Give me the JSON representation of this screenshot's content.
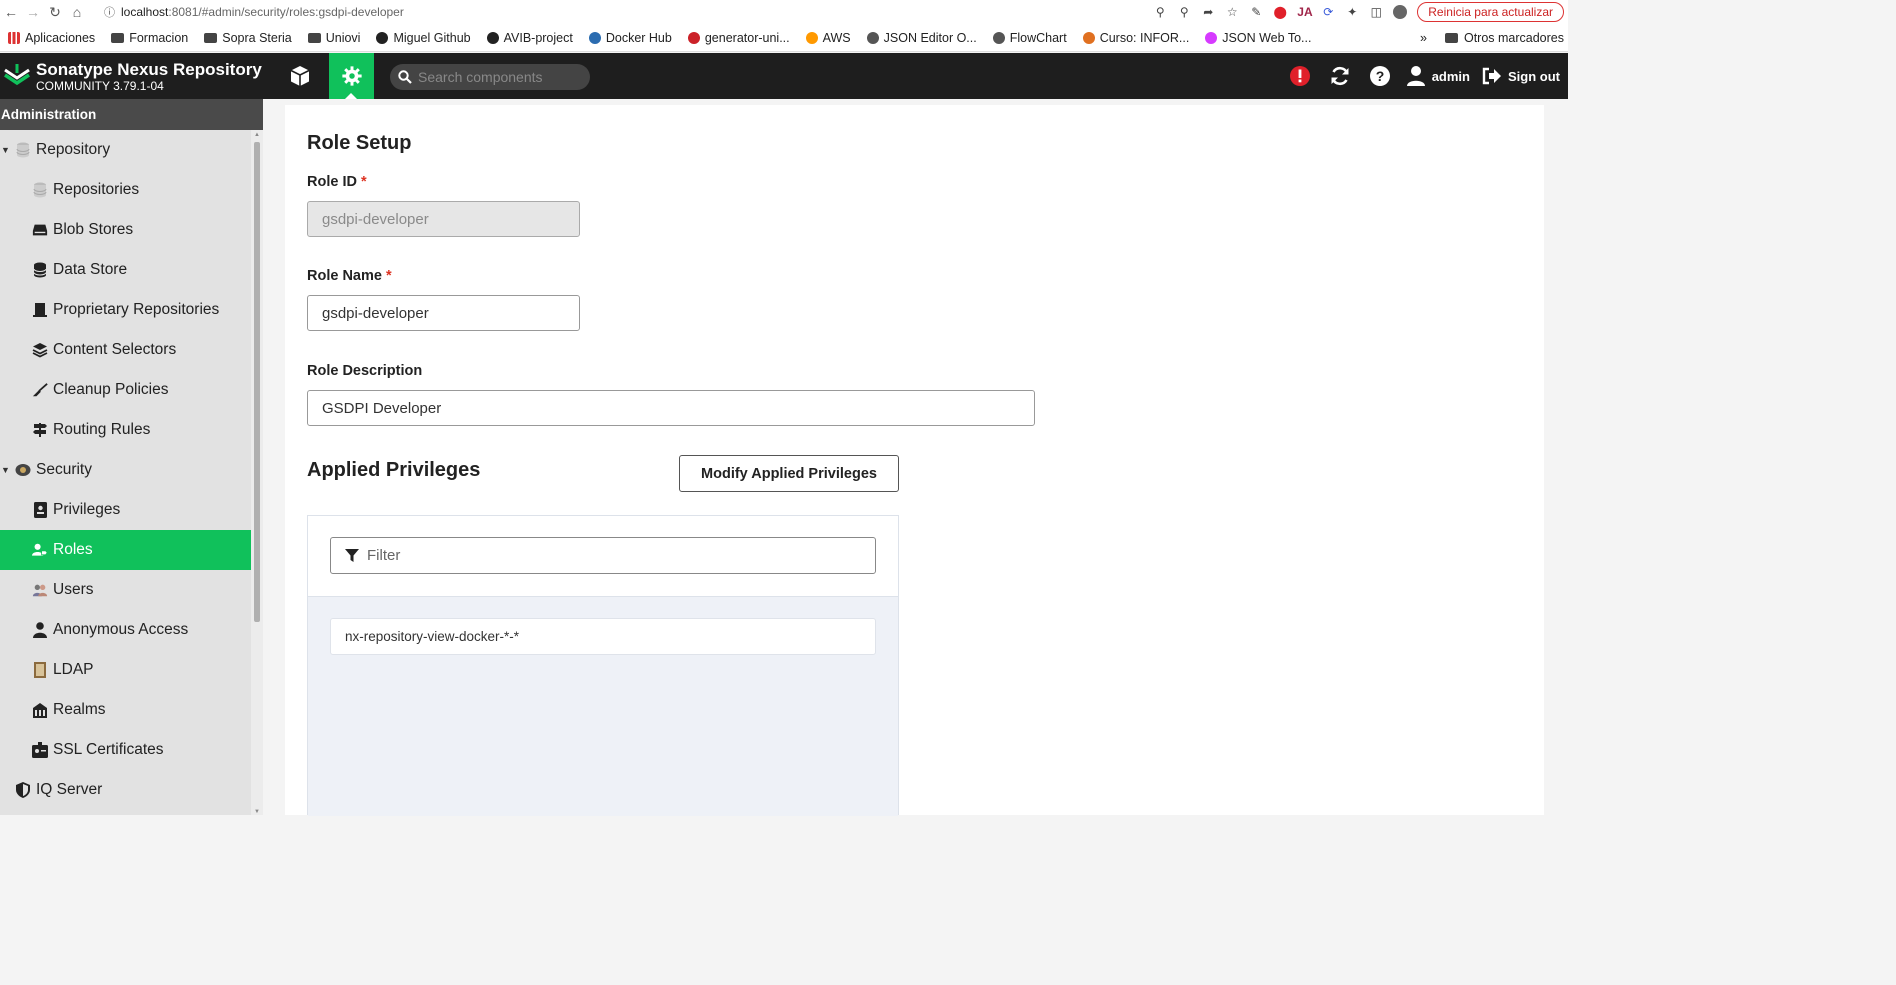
{
  "browser": {
    "url_host": "localhost",
    "url_path": ":8081/#admin/security/roles:gsdpi-developer",
    "update_button": "Reinicia para actualizar",
    "bookmarks": [
      {
        "label": "Aplicaciones",
        "icon": "apps-grid-icon",
        "color": "#d33"
      },
      {
        "label": "Formacion",
        "icon": "folder-icon",
        "color": "#444"
      },
      {
        "label": "Sopra Steria",
        "icon": "folder-icon",
        "color": "#444"
      },
      {
        "label": "Uniovi",
        "icon": "folder-icon",
        "color": "#444"
      },
      {
        "label": "Miguel Github",
        "icon": "github-icon",
        "color": "#222"
      },
      {
        "label": "AVIB-project",
        "icon": "github-icon",
        "color": "#222"
      },
      {
        "label": "Docker Hub",
        "icon": "docker-icon",
        "color": "#2b6cb0"
      },
      {
        "label": "generator-uni...",
        "icon": "npm-icon",
        "color": "#cb2128"
      },
      {
        "label": "AWS",
        "icon": "aws-icon",
        "color": "#ff9900"
      },
      {
        "label": "JSON Editor O...",
        "icon": "json-icon",
        "color": "#555"
      },
      {
        "label": "FlowChart",
        "icon": "flowchart-icon",
        "color": "#555"
      },
      {
        "label": "Curso: INFOR...",
        "icon": "course-icon",
        "color": "#e07020"
      },
      {
        "label": "JSON Web To...",
        "icon": "jwt-icon",
        "color": "#d63aff"
      }
    ],
    "other_bookmarks": "Otros marcadores"
  },
  "header": {
    "title": "Sonatype Nexus Repository",
    "version": "COMMUNITY 3.79.1-04",
    "search_placeholder": "Search components",
    "user": "admin",
    "signout": "Sign out",
    "accent_color": "#10c15b",
    "alert_color": "#e0202a"
  },
  "sidebar": {
    "heading": "Administration",
    "items": [
      {
        "label": "Repository",
        "type": "group",
        "icon": "database-icon"
      },
      {
        "label": "Repositories",
        "type": "child",
        "icon": "database-icon"
      },
      {
        "label": "Blob Stores",
        "type": "child",
        "icon": "hdd-icon"
      },
      {
        "label": "Data Store",
        "type": "child",
        "icon": "data-store-icon"
      },
      {
        "label": "Proprietary Repositories",
        "type": "child",
        "icon": "proprietary-icon"
      },
      {
        "label": "Content Selectors",
        "type": "child",
        "icon": "layers-icon"
      },
      {
        "label": "Cleanup Policies",
        "type": "child",
        "icon": "broom-icon"
      },
      {
        "label": "Routing Rules",
        "type": "child",
        "icon": "signpost-icon"
      },
      {
        "label": "Security",
        "type": "group",
        "icon": "badge-icon"
      },
      {
        "label": "Privileges",
        "type": "child",
        "icon": "id-badge-icon"
      },
      {
        "label": "Roles",
        "type": "child",
        "icon": "user-tag-icon",
        "active": true
      },
      {
        "label": "Users",
        "type": "child",
        "icon": "users-icon"
      },
      {
        "label": "Anonymous Access",
        "type": "child",
        "icon": "user-icon"
      },
      {
        "label": "LDAP",
        "type": "child",
        "icon": "book-icon"
      },
      {
        "label": "Realms",
        "type": "child",
        "icon": "realms-icon"
      },
      {
        "label": "SSL Certificates",
        "type": "child",
        "icon": "certificate-icon"
      },
      {
        "label": "IQ Server",
        "type": "group-collapsed",
        "icon": "shield-icon"
      }
    ]
  },
  "form": {
    "title": "Role Setup",
    "role_id_label": "Role ID",
    "role_id_value": "gsdpi-developer",
    "role_name_label": "Role Name",
    "role_name_value": "gsdpi-developer",
    "role_desc_label": "Role Description",
    "role_desc_value": "GSDPI Developer",
    "required_mark": "*",
    "privileges_title": "Applied Privileges",
    "modify_button": "Modify Applied Privileges",
    "filter_placeholder": "Filter",
    "privileges": [
      "nx-repository-view-docker-*-*"
    ]
  }
}
